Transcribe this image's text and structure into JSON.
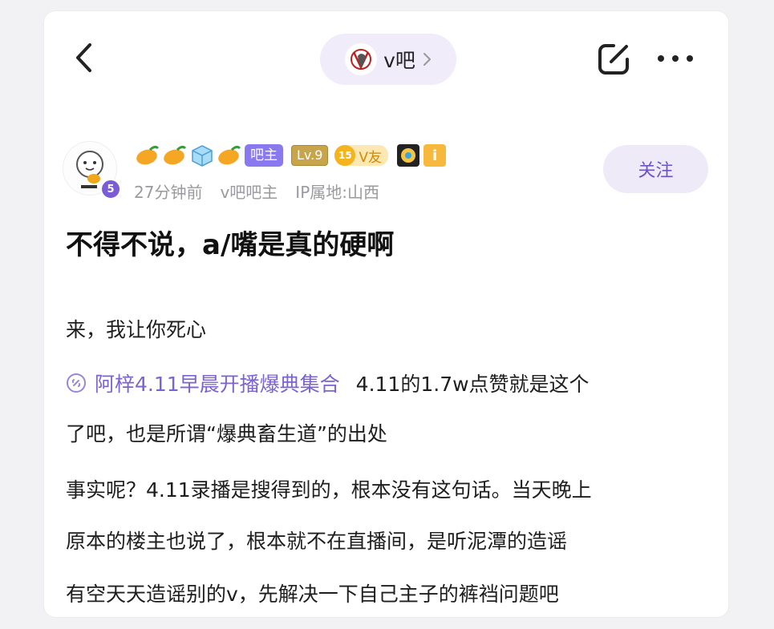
{
  "nav": {
    "forum_name": "v吧"
  },
  "author": {
    "level_badge": "5",
    "owner_badge": "吧主",
    "lv_badge": "Lv.9",
    "vfriend_num": "15",
    "vfriend_label": "V友",
    "time": "27分钟前",
    "role": "v吧吧主",
    "ip": "IP属地:山西",
    "follow_label": "关注"
  },
  "post": {
    "title": "不得不说，a/嘴是真的硬啊",
    "line1": "来，我让你死心",
    "link_text": "阿梓4.11早晨开播爆典集合",
    "link_after": "4.11的1.7w点赞就是这个",
    "line3": "了吧，也是所谓“爆典畜生道”的出处",
    "line4": "事实呢？4.11录播是搜得到的，根本没有这句话。当天晚上",
    "line5": "原本的楼主也说了，根本就不在直播间，是听泥潭的造谣",
    "line6": "有空天天造谣别的v，先解决一下自己主子的裤裆问题吧"
  },
  "colors": {
    "accent": "#7b63d0",
    "follow_bg": "#eeeaf8",
    "owner_badge": "#8a78ee"
  },
  "icons": [
    "back-icon",
    "chevron-right-icon",
    "share-icon",
    "more-icon",
    "link-icon",
    "mango-icon",
    "ice-cube-icon",
    "gear-badge-icon",
    "info-badge-icon"
  ]
}
